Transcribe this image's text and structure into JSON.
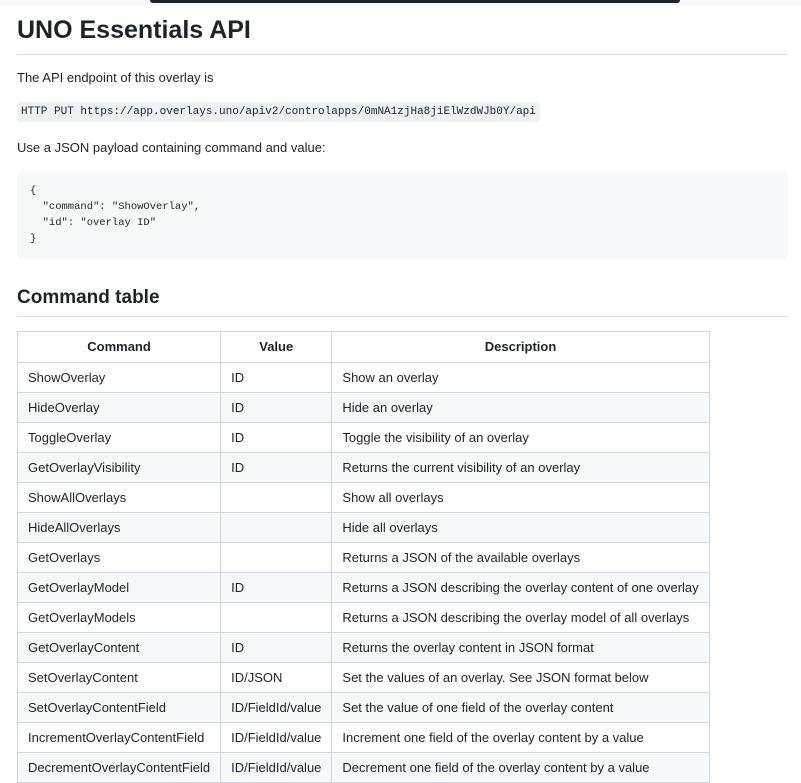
{
  "page": {
    "title": "UNO Essentials API",
    "endpoint_intro": "The API endpoint of this overlay is",
    "endpoint": "HTTP PUT https://app.overlays.uno/apiv2/controlapps/0mNA1zjHa8jiElWzdWJb0Y/api",
    "payload_intro": "Use a JSON payload containing command and value:",
    "payload_lines": [
      "{",
      "  \"command\": \"ShowOverlay\",",
      "  \"id\": \"overlay ID\"",
      "}"
    ],
    "command_table_heading": "Command table"
  },
  "command_table": {
    "headers": [
      "Command",
      "Value",
      "Description"
    ],
    "rows": [
      {
        "command": "ShowOverlay",
        "value": "ID",
        "description": "Show an overlay"
      },
      {
        "command": "HideOverlay",
        "value": "ID",
        "description": "Hide an overlay"
      },
      {
        "command": "ToggleOverlay",
        "value": "ID",
        "description": "Toggle the visibility of an overlay"
      },
      {
        "command": "GetOverlayVisibility",
        "value": "ID",
        "description": "Returns the current visibility of an overlay"
      },
      {
        "command": "ShowAllOverlays",
        "value": "",
        "description": "Show all overlays"
      },
      {
        "command": "HideAllOverlays",
        "value": "",
        "description": "Hide all overlays"
      },
      {
        "command": "GetOverlays",
        "value": "",
        "description": "Returns a JSON of the available overlays"
      },
      {
        "command": "GetOverlayModel",
        "value": "ID",
        "description": "Returns a JSON describing the overlay content of one overlay"
      },
      {
        "command": "GetOverlayModels",
        "value": "",
        "description": "Returns a JSON describing the overlay model of all overlays"
      },
      {
        "command": "GetOverlayContent",
        "value": "ID",
        "description": "Returns the overlay content in JSON format"
      },
      {
        "command": "SetOverlayContent",
        "value": "ID/JSON",
        "description": "Set the values of an overlay. See JSON format below"
      },
      {
        "command": "SetOverlayContentField",
        "value": "ID/FieldId/value",
        "description": "Set the value of one field of the overlay content"
      },
      {
        "command": "IncrementOverlayContentField",
        "value": "ID/FieldId/value",
        "description": "Increment one field of the overlay content by a value"
      },
      {
        "command": "DecrementOverlayContentField",
        "value": "ID/FieldId/value",
        "description": "Decrement one field of the overlay content by a value"
      }
    ]
  }
}
